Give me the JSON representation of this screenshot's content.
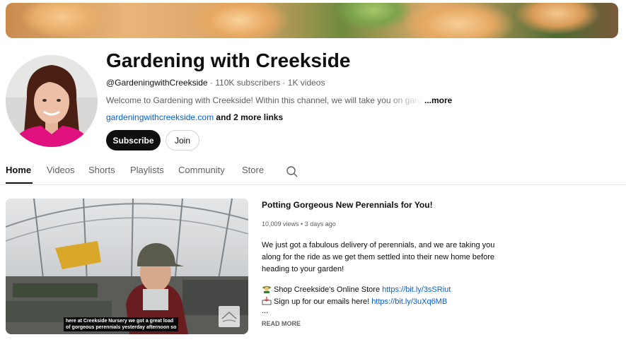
{
  "channel": {
    "name": "Gardening with Creekside",
    "handle": "@GardeningwithCreekside",
    "separator1": " · ",
    "subscribers": "110K subscribers",
    "separator2": " · ",
    "videos": "1K videos",
    "description": "Welcome to Gardening with Creekside! Within this channel, we will take you on garden tours",
    "more_label": "...more",
    "link": "gardeningwithcreekside.com",
    "more_links": " and 2 more links",
    "subscribe_label": "Subscribe",
    "join_label": "Join"
  },
  "tabs": [
    {
      "label": "Home",
      "active": true
    },
    {
      "label": "Videos"
    },
    {
      "label": "Shorts"
    },
    {
      "label": "Playlists"
    },
    {
      "label": "Community"
    },
    {
      "label": "Store"
    }
  ],
  "featured_video": {
    "caption_line1": "here at Creekside Nursery we got a great load",
    "caption_line2": "of gorgeous perennials yesterday afternoon so",
    "title": "Potting Gorgeous New Perennials for You!",
    "views": "10,009 views",
    "dot": " • ",
    "age": "3 days ago",
    "description": "We just got a fabulous delivery of perennials, and we are taking you along for the ride as we get them settled into their new home before heading to your garden!",
    "store_text": "Shop Creekside's Online Store ",
    "store_url": "https://bit.ly/3sSRiut",
    "store_icon": "farmer-emoji-icon",
    "email_text": "Sign up for our emails here! ",
    "email_url": "https://bit.ly/3uXq6MB",
    "email_icon": "inbox-tray-icon",
    "ellipsis": "...",
    "read_more": "READ MORE"
  },
  "colors": {
    "link": "#065fd4",
    "subscribe_bg": "#0f0f0f",
    "avatar_top": "#e10f8a"
  }
}
